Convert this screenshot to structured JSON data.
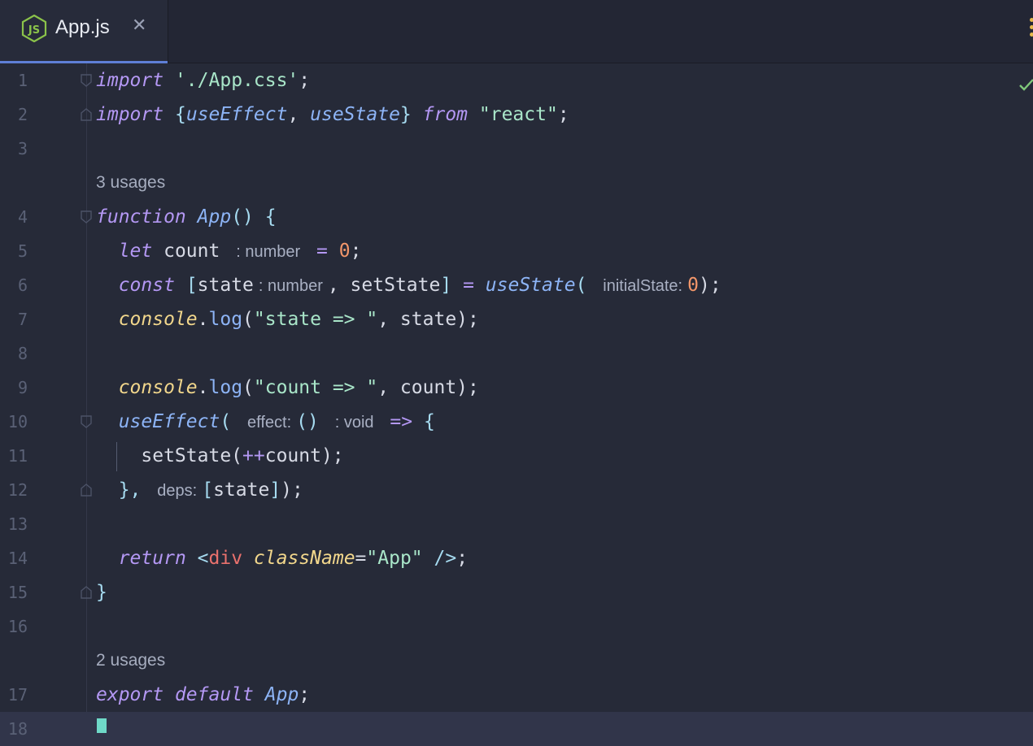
{
  "tab": {
    "label": "App.js",
    "close": "✕"
  },
  "colors": {
    "background": "#262a38",
    "accent": "#5f7fd6",
    "node_icon": "#8bc34a"
  },
  "line_numbers": [
    "1",
    "2",
    "3",
    "4",
    "5",
    "6",
    "7",
    "8",
    "9",
    "10",
    "11",
    "12",
    "13",
    "14",
    "15",
    "16",
    "17",
    "18"
  ],
  "inlays": {
    "usages_app": "3 usages",
    "usages_export": "2 usages",
    "count_type": ": number",
    "state_type": ": number",
    "initial_state": "initialState:",
    "effect": "effect:",
    "void_type": ": void",
    "deps": "deps:"
  },
  "code": {
    "l1_import": "import",
    "l1_str": "'./App.css'",
    "l1_end": ";",
    "l2_import": "import",
    "l2_open": "{",
    "l2_use_effect": "useEffect",
    "l2_comma": ", ",
    "l2_use_state": "useState",
    "l2_close": "}",
    "l2_from": "from",
    "l2_str": "\"react\"",
    "l2_end": ";",
    "l4_function": "function",
    "l4_name": "App",
    "l4_parens": "()",
    "l4_brace": "{",
    "l5_let": "let",
    "l5_var": "count",
    "l5_eq": "=",
    "l5_num": "0",
    "l5_end": ";",
    "l6_const": "const",
    "l6_open": "[",
    "l6_state": "state",
    "l6_set": ", setState",
    "l6_close": "]",
    "l6_eq": "=",
    "l6_fn": "useState",
    "l6_paren": "(",
    "l6_num": "0",
    "l6_end": ");",
    "l7_console": "console",
    "l7_dot": ".",
    "l7_log": "log",
    "l7_open": "(",
    "l7_str": "\"state => \"",
    "l7_rest": ", state);",
    "l9_console": "console",
    "l9_dot": ".",
    "l9_log": "log",
    "l9_open": "(",
    "l9_str": "\"count => \"",
    "l9_rest": ", count);",
    "l10_fn": "useEffect",
    "l10_paren": "(",
    "l10_arrow_parens": "()",
    "l10_arrow": "=>",
    "l10_brace": "{",
    "l11_call": "setState(",
    "l11_op": "++",
    "l11_rest": "count);",
    "l12_close": "},",
    "l12_open": "[",
    "l12_state": "state",
    "l12_close2": "]",
    "l12_end": ");",
    "l14_return": "return",
    "l14_lt": "<",
    "l14_tag": "div",
    "l14_attr": "className",
    "l14_eq": "=",
    "l14_str": "\"App\"",
    "l14_close": " />",
    "l14_end": ";",
    "l15_brace": "}",
    "l17_export": "export",
    "l17_default": "default",
    "l17_app": "App",
    "l17_end": ";"
  }
}
